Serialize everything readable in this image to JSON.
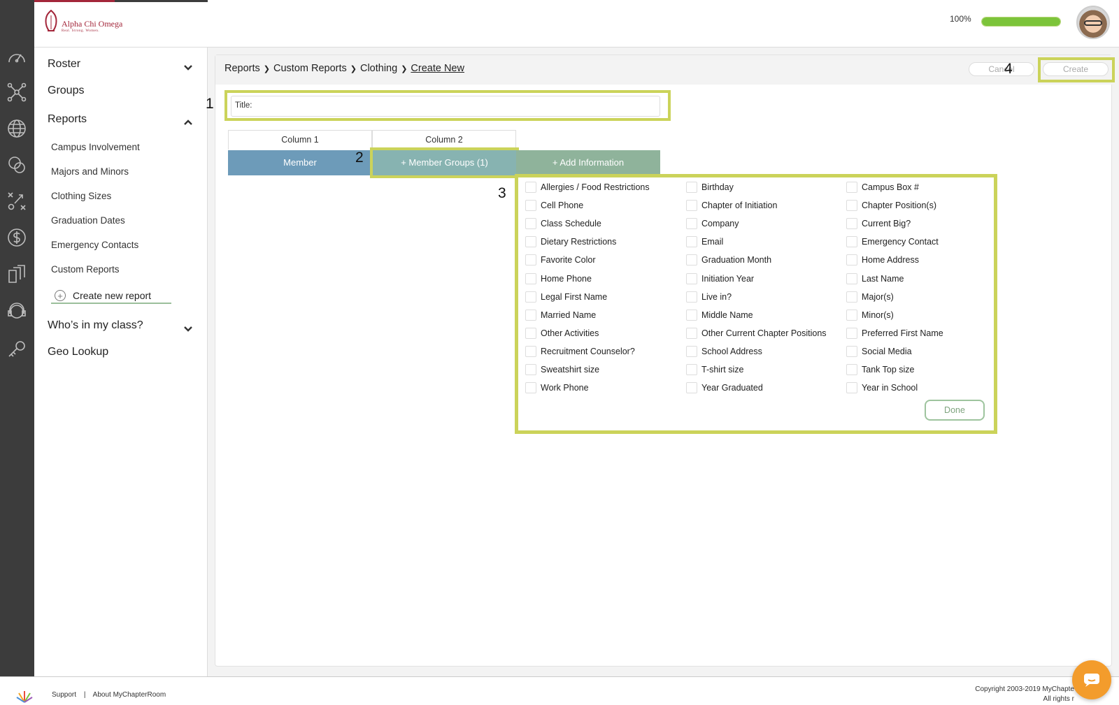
{
  "app": {
    "logo_name": "Alpha Chi Omega",
    "logo_tagline": "Real. Strong. Women."
  },
  "header": {
    "progress_text": "100%",
    "progress_fraction": 1.0
  },
  "rail": {
    "icons": [
      "dashboard-icon",
      "network-icon",
      "globe-icon",
      "chat-bubbles-icon",
      "strategy-icon",
      "dollar-icon",
      "documents-icon",
      "support-headset-icon",
      "keys-icon"
    ]
  },
  "sidebar": {
    "roster": "Roster",
    "groups": "Groups",
    "reports": "Reports",
    "report_items": [
      "Campus Involvement",
      "Majors and Minors",
      "Clothing Sizes",
      "Graduation Dates",
      "Emergency Contacts",
      "Custom Reports"
    ],
    "create_new_report": "Create new report",
    "whos_in_my_class": "Who’s in my class?",
    "geo_lookup": "Geo Lookup"
  },
  "breadcrumb": {
    "items": [
      "Reports",
      "Custom Reports",
      "Clothing"
    ],
    "current": "Create New"
  },
  "actions": {
    "cancel": "Cancel",
    "create": "Create"
  },
  "callouts": [
    "1",
    "2",
    "3",
    "4"
  ],
  "form": {
    "title_label": "Title:"
  },
  "columns": {
    "headers": [
      "Column 1",
      "Column 2"
    ],
    "member": "Member",
    "member_groups": "+ Member Groups (1)",
    "add_information": "+ Add Information"
  },
  "information_options": [
    [
      "Allergies / Food Restrictions",
      "Birthday",
      "Campus Box #"
    ],
    [
      "Cell Phone",
      "Chapter of Initiation",
      "Chapter Position(s)"
    ],
    [
      "Class Schedule",
      "Company",
      "Current Big?"
    ],
    [
      "Dietary Restrictions",
      "Email",
      "Emergency Contact"
    ],
    [
      "Favorite Color",
      "Graduation Month",
      "Home Address"
    ],
    [
      "Home Phone",
      "Initiation Year",
      "Last Name"
    ],
    [
      "Legal First Name",
      "Live in?",
      "Major(s)"
    ],
    [
      "Married Name",
      "Middle Name",
      "Minor(s)"
    ],
    [
      "Other Activities",
      "Other Current Chapter Positions",
      "Preferred First Name"
    ],
    [
      "Recruitment Counselor?",
      "School Address",
      "Social Media"
    ],
    [
      "Sweatshirt size",
      "T-shirt size",
      "Tank Top size"
    ],
    [
      "Work Phone",
      "Year Graduated",
      "Year in School"
    ]
  ],
  "done": "Done",
  "footer": {
    "support": "Support",
    "separator": "|",
    "about": "About MyChapterRoom",
    "copyright_line1": "Copyright 2003-2019 MyChapte",
    "copyright_line2": "All rights r"
  },
  "colors": {
    "highlight": "#cbd35a",
    "brand": "#a3263a",
    "progress": "#7cc43a",
    "member_col": "#6d9bb9",
    "groups_col": "#87b3b1",
    "add_col": "#8fb39b",
    "chat": "#f39c2c"
  }
}
